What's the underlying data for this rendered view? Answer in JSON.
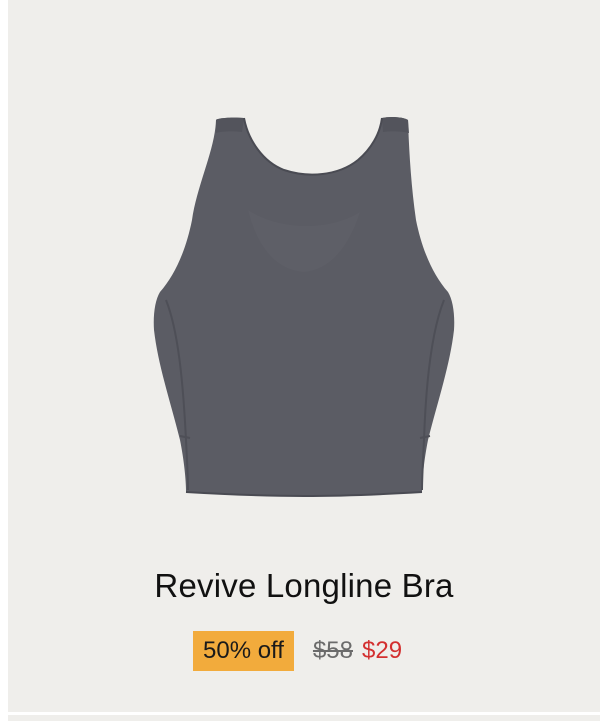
{
  "product": {
    "title": "Revive Longline Bra",
    "image_icon": "sports-bra-product-photo",
    "garment_color": "#5b5c64",
    "background_color": "#efeeeb"
  },
  "pricing": {
    "discount_label": "50% off",
    "original_price": "$58",
    "sale_price": "$29",
    "badge_color": "#f2ab3c",
    "sale_color": "#d32f2f"
  }
}
